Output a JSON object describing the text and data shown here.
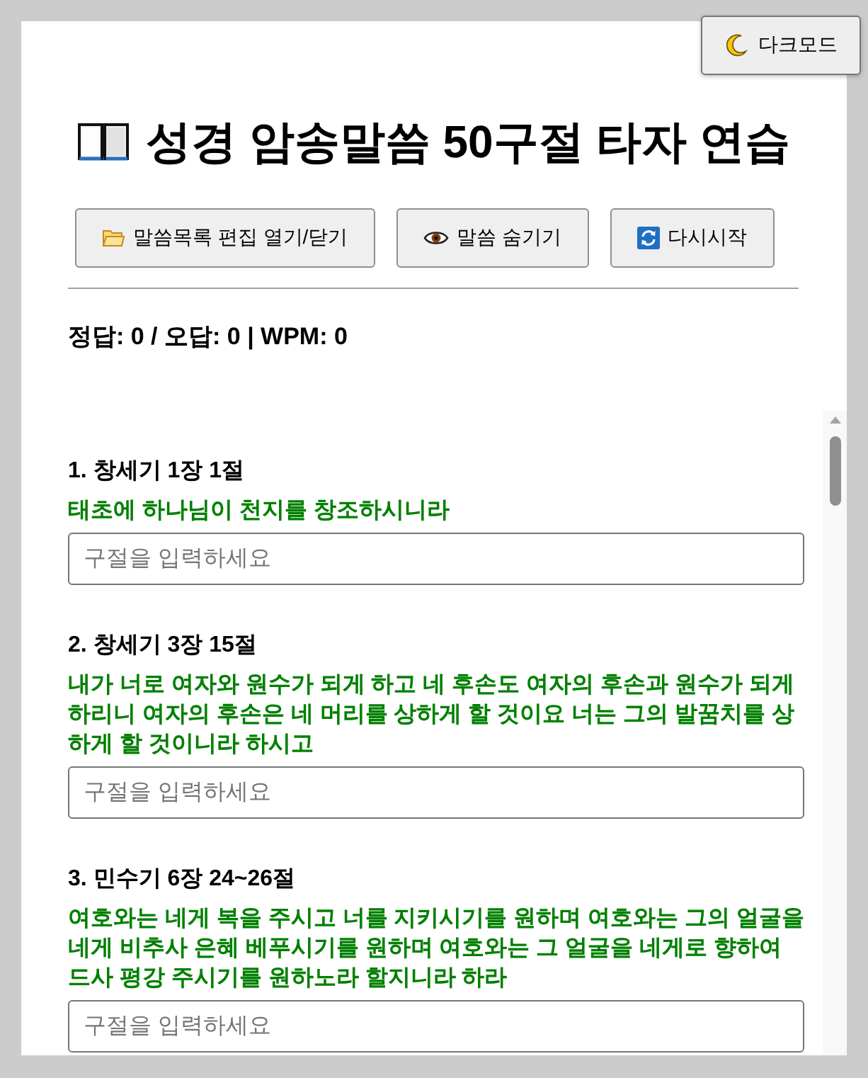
{
  "dark_mode_button": {
    "label": "다크모드"
  },
  "title": "성경 암송말씀 50구절 타자 연습",
  "toolbar": [
    {
      "label": "말씀목록 편집 열기/닫기"
    },
    {
      "label": "말씀 숨기기"
    },
    {
      "label": "다시시작"
    }
  ],
  "score": "정답: 0 / 오답: 0 | WPM: 0",
  "verses": [
    {
      "reference": "1. 창세기 1장 1절",
      "text": "태초에 하나님이 천지를 창조하시니라",
      "input": {
        "placeholder": "구절을 입력하세요"
      }
    },
    {
      "reference": "2. 창세기 3장 15절",
      "text": "내가 너로 여자와 원수가 되게 하고 네 후손도 여자의 후손과 원수가 되게 하리니 여자의 후손은 네 머리를 상하게 할 것이요 너는 그의 발꿈치를 상하게 할 것이니라 하시고",
      "input": {
        "placeholder": "구절을 입력하세요"
      }
    },
    {
      "reference": "3. 민수기 6장 24~26절",
      "text": "여호와는 네게 복을 주시고 너를 지키시기를 원하며 여호와는 그의 얼굴을 네게 비추사 은혜 베푸시기를 원하며 여호와는 그 얼굴을 네게로 향하여 드사 평강 주시기를 원하노라 할지니라 하라",
      "input": {
        "placeholder": "구절을 입력하세요"
      }
    }
  ]
}
